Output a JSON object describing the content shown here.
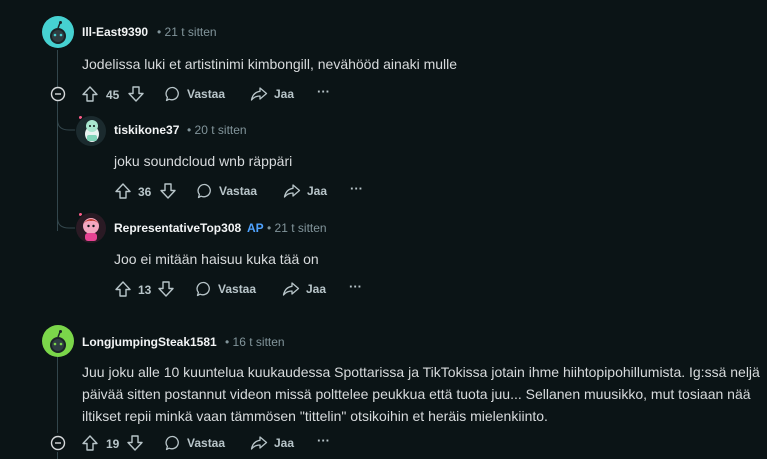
{
  "comments": [
    {
      "username": "Ill-East9390",
      "separator": "•",
      "time": "21 t sitten",
      "text": "Jodelissa luki et artistinimi kimbongill, nevähööd ainaki mulle",
      "votes": "45",
      "reply_label": "Vastaa",
      "share_label": "Jaa",
      "more_label": "···",
      "avatar_color": "#46d1d1",
      "replies": [
        {
          "username": "tiskikone37",
          "separator": "•",
          "time": "20 t sitten",
          "text": "joku soundcloud wnb räppäri",
          "votes": "36",
          "reply_label": "Vastaa",
          "share_label": "Jaa",
          "more_label": "···"
        },
        {
          "username": "RepresentativeTop308",
          "badge": "AP",
          "separator": "•",
          "time": "21 t sitten",
          "text": "Joo ei mitään haisuu kuka tää on",
          "votes": "13",
          "reply_label": "Vastaa",
          "share_label": "Jaa",
          "more_label": "···"
        }
      ]
    },
    {
      "username": "LongjumpingSteak1581",
      "separator": "•",
      "time": "16 t sitten",
      "text_lines": [
        "Juu joku alle 10 kuuntelua kuukaudessa Spottarissa ja TikTokissa jotain ihme hiihtopipohillumista. Ig:ssä neljä",
        "päivää sitten postannut videon missä polttelee peukkua että tuota juu... Sellanen muusikko, mut tosiaan nää",
        "iltikset repii minkä vaan tämmösen \"tittelin\" otsikoihin et heräis mielenkiinto."
      ],
      "votes": "19",
      "reply_label": "Vastaa",
      "share_label": "Jaa",
      "more_label": "···",
      "avatar_color": "#7bd64a"
    }
  ]
}
